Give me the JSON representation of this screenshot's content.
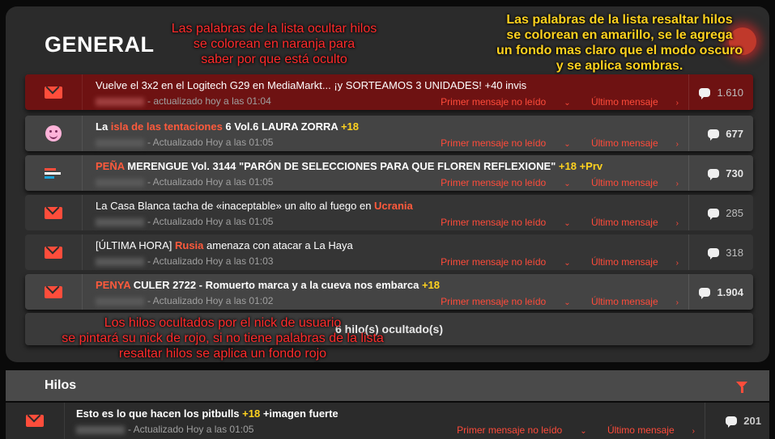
{
  "section_title": "GENERAL",
  "notes": {
    "ocultar": [
      "Las palabras de la lista ocultar hilos",
      "se colorean en naranja para",
      "saber por que está oculto"
    ],
    "resaltar": [
      "Las palabras de la lista resaltar hilos",
      "se colorean en amarillo, se le agrega",
      "un fondo mas claro que el modo oscuro",
      "y se aplica sombras."
    ],
    "nick": [
      "Los  hilos ocultados por el nick de usuario",
      "se pintará su nick de rojo, si no tiene palabras de la lista",
      "resaltar hilos se aplica un fondo rojo"
    ]
  },
  "labels": {
    "first_unread": "Primer mensaje no leído",
    "last_message": "Último mensaje"
  },
  "threads": [
    {
      "title_parts": [
        {
          "t": "Vuelve el 3x2 en el Logitech G29 en MediaMarkt... ¡y SORTEAMOS 3 UNIDADES! +40 invis",
          "c": ""
        }
      ],
      "meta": "- actualizado hoy a las 01:04",
      "count": "1.610"
    },
    {
      "title_parts": [
        {
          "t": "La ",
          "c": ""
        },
        {
          "t": "isla de las tentaciones",
          "c": "orange"
        },
        {
          "t": " 6 Vol.6 LAURA ZORRA ",
          "c": ""
        },
        {
          "t": "+18",
          "c": "yellow"
        }
      ],
      "meta": "- Actualizado Hoy a las 01:05",
      "count": "677"
    },
    {
      "title_parts": [
        {
          "t": "PEÑA",
          "c": "orange"
        },
        {
          "t": " MERENGUE Vol. 3144 \"PARÓN DE SELECCIONES PARA QUE FLOREN REFLEXIONE\" ",
          "c": ""
        },
        {
          "t": "+18 +Prv",
          "c": "yellow"
        }
      ],
      "meta": "- Actualizado Hoy a las 01:05",
      "count": "730"
    },
    {
      "title_parts": [
        {
          "t": "La Casa Blanca tacha de «inaceptable» un alto al fuego en ",
          "c": ""
        },
        {
          "t": "Ucrania",
          "c": "orange"
        }
      ],
      "meta": "- Actualizado Hoy a las 01:05",
      "count": "285"
    },
    {
      "title_parts": [
        {
          "t": "[ÚLTIMA HORA] ",
          "c": ""
        },
        {
          "t": "Rusia",
          "c": "orange"
        },
        {
          "t": " amenaza con atacar a La Haya",
          "c": ""
        }
      ],
      "meta": "- Actualizado Hoy a las 01:03",
      "count": "318"
    },
    {
      "title_parts": [
        {
          "t": "PENYA",
          "c": "orange"
        },
        {
          "t": " CULER 2722 - Romuerto marca y a la cueva nos embarca ",
          "c": ""
        },
        {
          "t": "+18",
          "c": "yellow"
        }
      ],
      "meta": "- Actualizado Hoy a las 01:02",
      "count": "1.904"
    }
  ],
  "hidden_threads_label": "6 hilo(s) ocultado(s)",
  "hilos_section": {
    "label": "Hilos",
    "thread": {
      "title_parts": [
        {
          "t": "Esto es lo que hacen los pitbulls ",
          "c": ""
        },
        {
          "t": "+18",
          "c": "yellow"
        },
        {
          "t": " +imagen fuerte",
          "c": ""
        }
      ],
      "meta": "- Actualizado Hoy a las 01:05",
      "count": "201"
    }
  },
  "colors": {
    "accent": "#ff4d3b",
    "highlight": "#ffd21f",
    "hidden_word": "#ff5a3c",
    "nick_red_bg": "#6e1212"
  },
  "icons": [
    "mail-icon",
    "smiley-icon",
    "flag-icon",
    "chat-bubble-icon",
    "chevron-down-icon",
    "chevron-right-icon",
    "filter-icon"
  ]
}
